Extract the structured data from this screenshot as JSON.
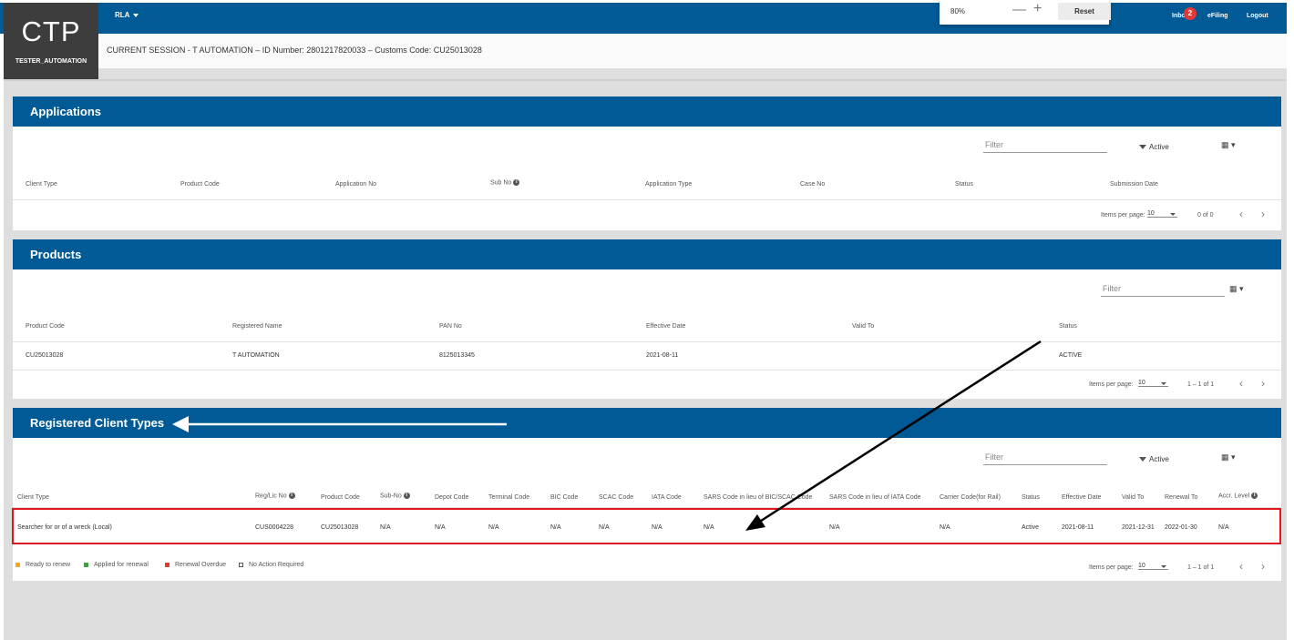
{
  "brand": {
    "name": "CTP",
    "user": "TESTER_AUTOMATION"
  },
  "nav": {
    "menu_label": "RLA",
    "inbox": "Inbox",
    "inbox_count": "2",
    "efiling": "eFiling",
    "logout": "Logout"
  },
  "zoom": {
    "level": "80%",
    "minus": "—",
    "plus": "+",
    "reset": "Reset"
  },
  "session": {
    "text": "CURRENT SESSION - T AUTOMATION – ID Number: 2801217820033 – Customs Code: CU25013028"
  },
  "applications": {
    "title": "Applications",
    "filter_placeholder": "Filter",
    "status_filter": "Active",
    "columns": [
      "Client Type",
      "Product Code",
      "Application No",
      "Sub No",
      "Application Type",
      "Case No",
      "Status",
      "Submission Date"
    ],
    "paging": {
      "label": "Items per page:",
      "size": "10",
      "range": "0 of 0"
    }
  },
  "products": {
    "title": "Products",
    "filter_placeholder": "Filter",
    "columns": [
      "Product Code",
      "Registered Name",
      "PAN No",
      "Effective Date",
      "Valid To",
      "Status"
    ],
    "rows": [
      [
        "CU25013028",
        "T AUTOMATION",
        "8125013345",
        "2021-08-11",
        "",
        "ACTIVE"
      ]
    ],
    "paging": {
      "label": "Items per page:",
      "size": "10",
      "range": "1 – 1 of 1"
    }
  },
  "registered": {
    "title": "Registered Client Types",
    "filter_placeholder": "Filter",
    "status_filter": "Active",
    "columns": [
      "Client Type",
      "Reg/Lic No",
      "Product Code",
      "Sub-No",
      "Depot Code",
      "Terminal Code",
      "BIC Code",
      "SCAC Code",
      "IATA Code",
      "SARS Code in lieu of BIC/SCAC Code",
      "SARS Code in lieu of IATA Code",
      "Carrier Code(for Rail)",
      "Status",
      "Effective Date",
      "Valid To",
      "Renewal To",
      "Accr. Level"
    ],
    "rows": [
      [
        "Searcher for or of a wreck (Local)",
        "CUS0004228",
        "CU25013028",
        "N/A",
        "N/A",
        "N/A",
        "N/A",
        "N/A",
        "N/A",
        "N/A",
        "N/A",
        "N/A",
        "Active",
        "2021-08-11",
        "2021-12-31",
        "2022-01-30",
        "N/A"
      ]
    ],
    "legend": [
      "Ready to renew",
      "Applied for renewal",
      "Renewal Overdue",
      "No Action Required"
    ],
    "paging": {
      "label": "Items per page:",
      "size": "10",
      "range": "1 – 1 of 1"
    }
  },
  "colors": {
    "primary": "#005a96",
    "logo_bg": "#3d3d3d",
    "highlight": "#e0171f",
    "legend": [
      "#f5a623",
      "#43a047",
      "#e53935",
      "#ffffff"
    ]
  },
  "icons": [
    "caret-down-icon",
    "filter-icon",
    "grid-icon",
    "info-icon",
    "chevron-left-icon",
    "chevron-right-icon"
  ]
}
